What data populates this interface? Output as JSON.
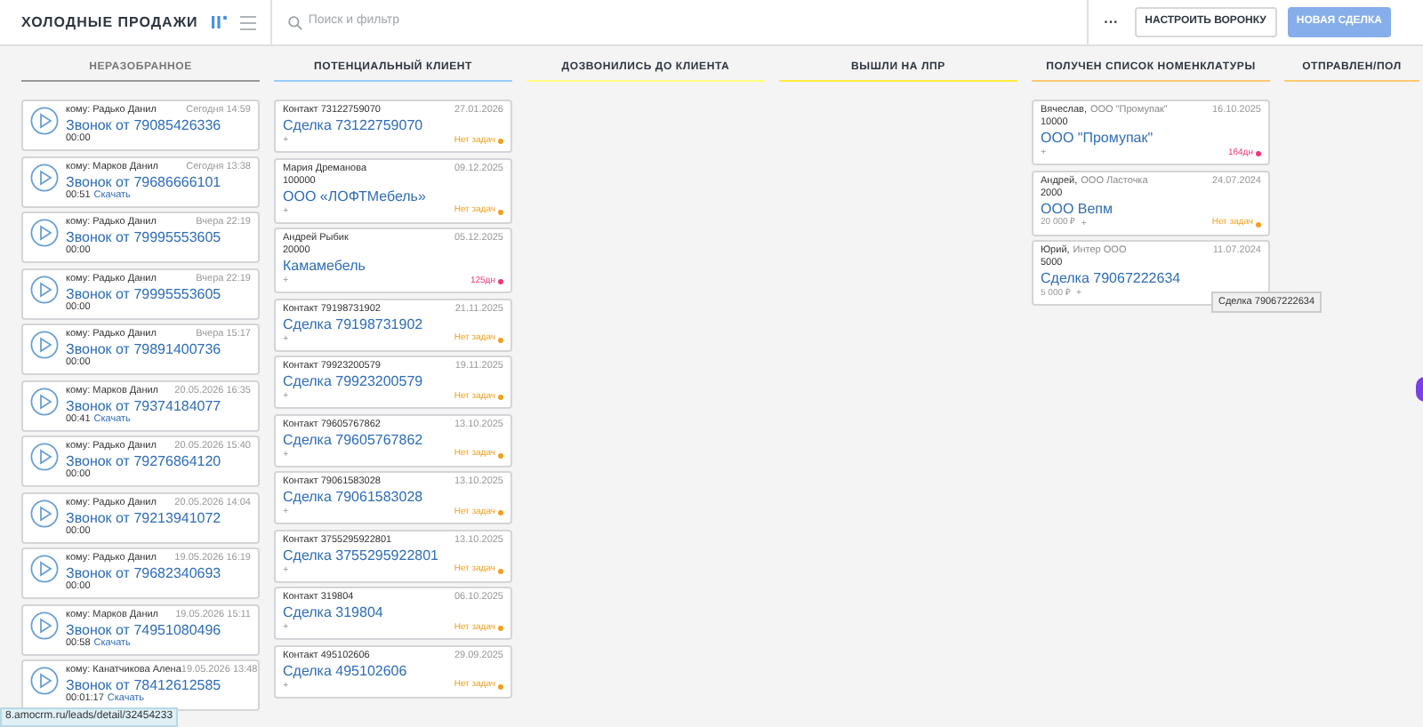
{
  "header": {
    "title": "ХОЛОДНЫЕ ПРОДАЖИ",
    "search": {
      "placeholder": "Поиск и фильтр"
    },
    "more": "···",
    "buttons": [
      {
        "label": "НАСТРОИТЬ ВОРОНКУ",
        "kind": "outline"
      },
      {
        "label": "НОВАЯ СДЕЛКА",
        "kind": "primary",
        "disabled": true
      }
    ]
  },
  "columns": [
    {
      "title": "НЕРАЗОБРАННОЕ",
      "color": "#999999",
      "muted": true,
      "cards": [
        {
          "kind": "call",
          "recipient": "кому: Радько Данил",
          "time": "Сегодня 14:59",
          "title": "Звонок от 79085426336",
          "duration": "00:00"
        },
        {
          "kind": "call",
          "recipient": "кому: Марков Данил",
          "time": "Сегодня 13:38",
          "title": "Звонок от 79686666101",
          "duration": "00:51",
          "download": "Скачать"
        },
        {
          "kind": "call",
          "recipient": "кому: Радько Данил",
          "time": "Вчера 22:19",
          "title": "Звонок от 79995553605",
          "duration": "00:00"
        },
        {
          "kind": "call",
          "recipient": "кому: Радько Данил",
          "time": "Вчера 22:19",
          "title": "Звонок от 79995553605",
          "duration": "00:00"
        },
        {
          "kind": "call",
          "recipient": "кому: Радько Данил",
          "time": "Вчера 15:17",
          "title": "Звонок от 79891400736",
          "duration": "00:00"
        },
        {
          "kind": "call",
          "recipient": "кому: Марков Данил",
          "time": "20.05.2026 16:35",
          "title": "Звонок от 79374184077",
          "duration": "00:41",
          "download": "Скачать"
        },
        {
          "kind": "call",
          "recipient": "кому: Радько Данил",
          "time": "20.05.2026 15:40",
          "title": "Звонок от 79276864120",
          "duration": "00:00"
        },
        {
          "kind": "call",
          "recipient": "кому: Радько Данил",
          "time": "20.05.2026 14:04",
          "title": "Звонок от 79213941072",
          "duration": "00:00"
        },
        {
          "kind": "call",
          "recipient": "кому: Радько Данил",
          "time": "19.05.2026 16:19",
          "title": "Звонок от 79682340693",
          "duration": "00:00"
        },
        {
          "kind": "call",
          "recipient": "кому: Марков Данил",
          "time": "19.05.2026 15:11",
          "title": "Звонок от 74951080496",
          "duration": "00:58",
          "download": "Скачать"
        },
        {
          "kind": "call",
          "recipient": "кому: Канатчикова Алена",
          "time": "19.05.2026 13:48",
          "title": "Звонок от 78412612585",
          "duration": "00:01:17",
          "download": "Скачать"
        }
      ]
    },
    {
      "title": "ПОТЕНЦИАЛЬНЫЙ КЛИЕНТ",
      "color": "#99ccff",
      "muted": false,
      "cards": [
        {
          "kind": "lead",
          "contact": "Контакт 73122759070",
          "date": "27.01.2026",
          "title": "Сделка 73122759070",
          "add": "+",
          "task": {
            "text": "Нет задач",
            "color": "#f0a020"
          }
        },
        {
          "kind": "lead",
          "contact": "Мария Дреманова",
          "date": "09.12.2025",
          "amount": "100000",
          "title": "ООО «ЛОФТМебель»",
          "add": "+",
          "task": {
            "text": "Нет задач",
            "color": "#f0a020"
          }
        },
        {
          "kind": "lead",
          "contact": "Андрей Рыбик",
          "date": "05.12.2025",
          "amount": "20000",
          "title": "Камамебель",
          "add": "+",
          "task": {
            "text": "125дн",
            "color": "#f0357a"
          }
        },
        {
          "kind": "lead",
          "contact": "Контакт 79198731902",
          "date": "21.11.2025",
          "title": "Сделка 79198731902",
          "add": "+",
          "task": {
            "text": "Нет задач",
            "color": "#f0a020"
          }
        },
        {
          "kind": "lead",
          "contact": "Контакт 79923200579",
          "date": "19.11.2025",
          "title": "Сделка 79923200579",
          "add": "+",
          "task": {
            "text": "Нет задач",
            "color": "#f0a020"
          }
        },
        {
          "kind": "lead",
          "contact": "Контакт 79605767862",
          "date": "13.10.2025",
          "title": "Сделка 79605767862",
          "add": "+",
          "task": {
            "text": "Нет задач",
            "color": "#f0a020"
          }
        },
        {
          "kind": "lead",
          "contact": "Контакт 79061583028",
          "date": "13.10.2025",
          "title": "Сделка 79061583028",
          "add": "+",
          "task": {
            "text": "Нет задач",
            "color": "#f0a020"
          }
        },
        {
          "kind": "lead",
          "contact": "Контакт 3755295922801",
          "date": "13.10.2025",
          "title": "Сделка 3755295922801",
          "add": "+",
          "task": {
            "text": "Нет задач",
            "color": "#f0a020"
          }
        },
        {
          "kind": "lead",
          "contact": "Контакт 319804",
          "date": "06.10.2025",
          "title": "Сделка 319804",
          "add": "+",
          "task": {
            "text": "Нет задач",
            "color": "#f0a020"
          }
        },
        {
          "kind": "lead",
          "contact": "Контакт 495102606",
          "date": "29.09.2025",
          "title": "Сделка 495102606",
          "add": "+",
          "task": {
            "text": "Нет задач",
            "color": "#f0a020"
          }
        }
      ]
    },
    {
      "title": "ДОЗВОНИЛИСЬ ДО КЛИЕНТА",
      "color": "#fffd7f",
      "muted": false
    },
    {
      "title": "ВЫШЛИ НА ЛПР",
      "color": "#ffeb3b",
      "muted": false
    },
    {
      "title": "ПОЛУЧЕН СПИСОК НОМЕНКЛАТУРЫ",
      "color": "#ffc970",
      "muted": false,
      "cards": [
        {
          "kind": "lead",
          "contact": "Вячеслав,",
          "company": "ООО \"Промупак\"",
          "date": "16.10.2025",
          "amount": "10000",
          "title": "ООО \"Промупак\"",
          "add": "+",
          "task": {
            "text": "164дн",
            "color": "#f0357a"
          }
        },
        {
          "kind": "lead",
          "contact": "Андрей,",
          "company": "ООО Ласточка",
          "date": "24.07.2024",
          "amount": "2000",
          "title": "ООО Вепм",
          "price": "20 000 ₽",
          "add": "+",
          "task": {
            "text": "Нет задач",
            "color": "#f0a020"
          }
        },
        {
          "kind": "lead",
          "contact": "Юрий,",
          "company": "Интер ООО",
          "date": "11.07.2024",
          "amount": "5000",
          "title": "Сделка 79067222634",
          "price": "5 000 ₽",
          "add": "+",
          "tooltip": "Сделка 79067222634"
        }
      ]
    },
    {
      "title": "ОТПРАВЛЕН/ПОЛ",
      "color": "#ffc970",
      "muted": false
    }
  ],
  "status_bar": "8.amocrm.ru/leads/detail/32454233"
}
